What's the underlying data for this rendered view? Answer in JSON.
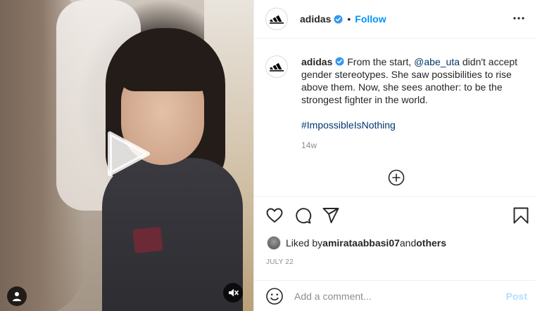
{
  "media": {
    "play_icon": "play-icon",
    "user_tag_icon": "user-icon",
    "mute_icon": "speaker-muted-icon"
  },
  "header": {
    "username": "adidas",
    "verified_icon": "verified-badge-icon",
    "separator": "•",
    "follow_label": "Follow",
    "more_icon": "more-horizontal-icon"
  },
  "caption": {
    "username": "adidas",
    "text_before": " From the start, ",
    "mention": "@abe_uta",
    "text_after": " didn't accept gender stereotypes. She saw possibilities to rise above them. Now, she sees another: to be the strongest fighter in the world.",
    "hashtag": "#ImpossibleIsNothing",
    "time": "14w"
  },
  "load_more_icon": "plus-circle-icon",
  "actions": {
    "like_icon": "heart-icon",
    "comment_icon": "comment-icon",
    "share_icon": "paper-plane-icon",
    "save_icon": "bookmark-icon"
  },
  "likes": {
    "prefix": "Liked by ",
    "user": "amirataabbasi07",
    "middle": " and ",
    "others": "others"
  },
  "date": "JULY 22",
  "comment": {
    "emoji_icon": "smiley-icon",
    "placeholder": "Add a comment...",
    "post_label": "Post"
  },
  "colors": {
    "accent": "#0095f6",
    "post_disabled": "#b2dffc",
    "link": "#00376b",
    "muted": "#8e8e8e"
  }
}
